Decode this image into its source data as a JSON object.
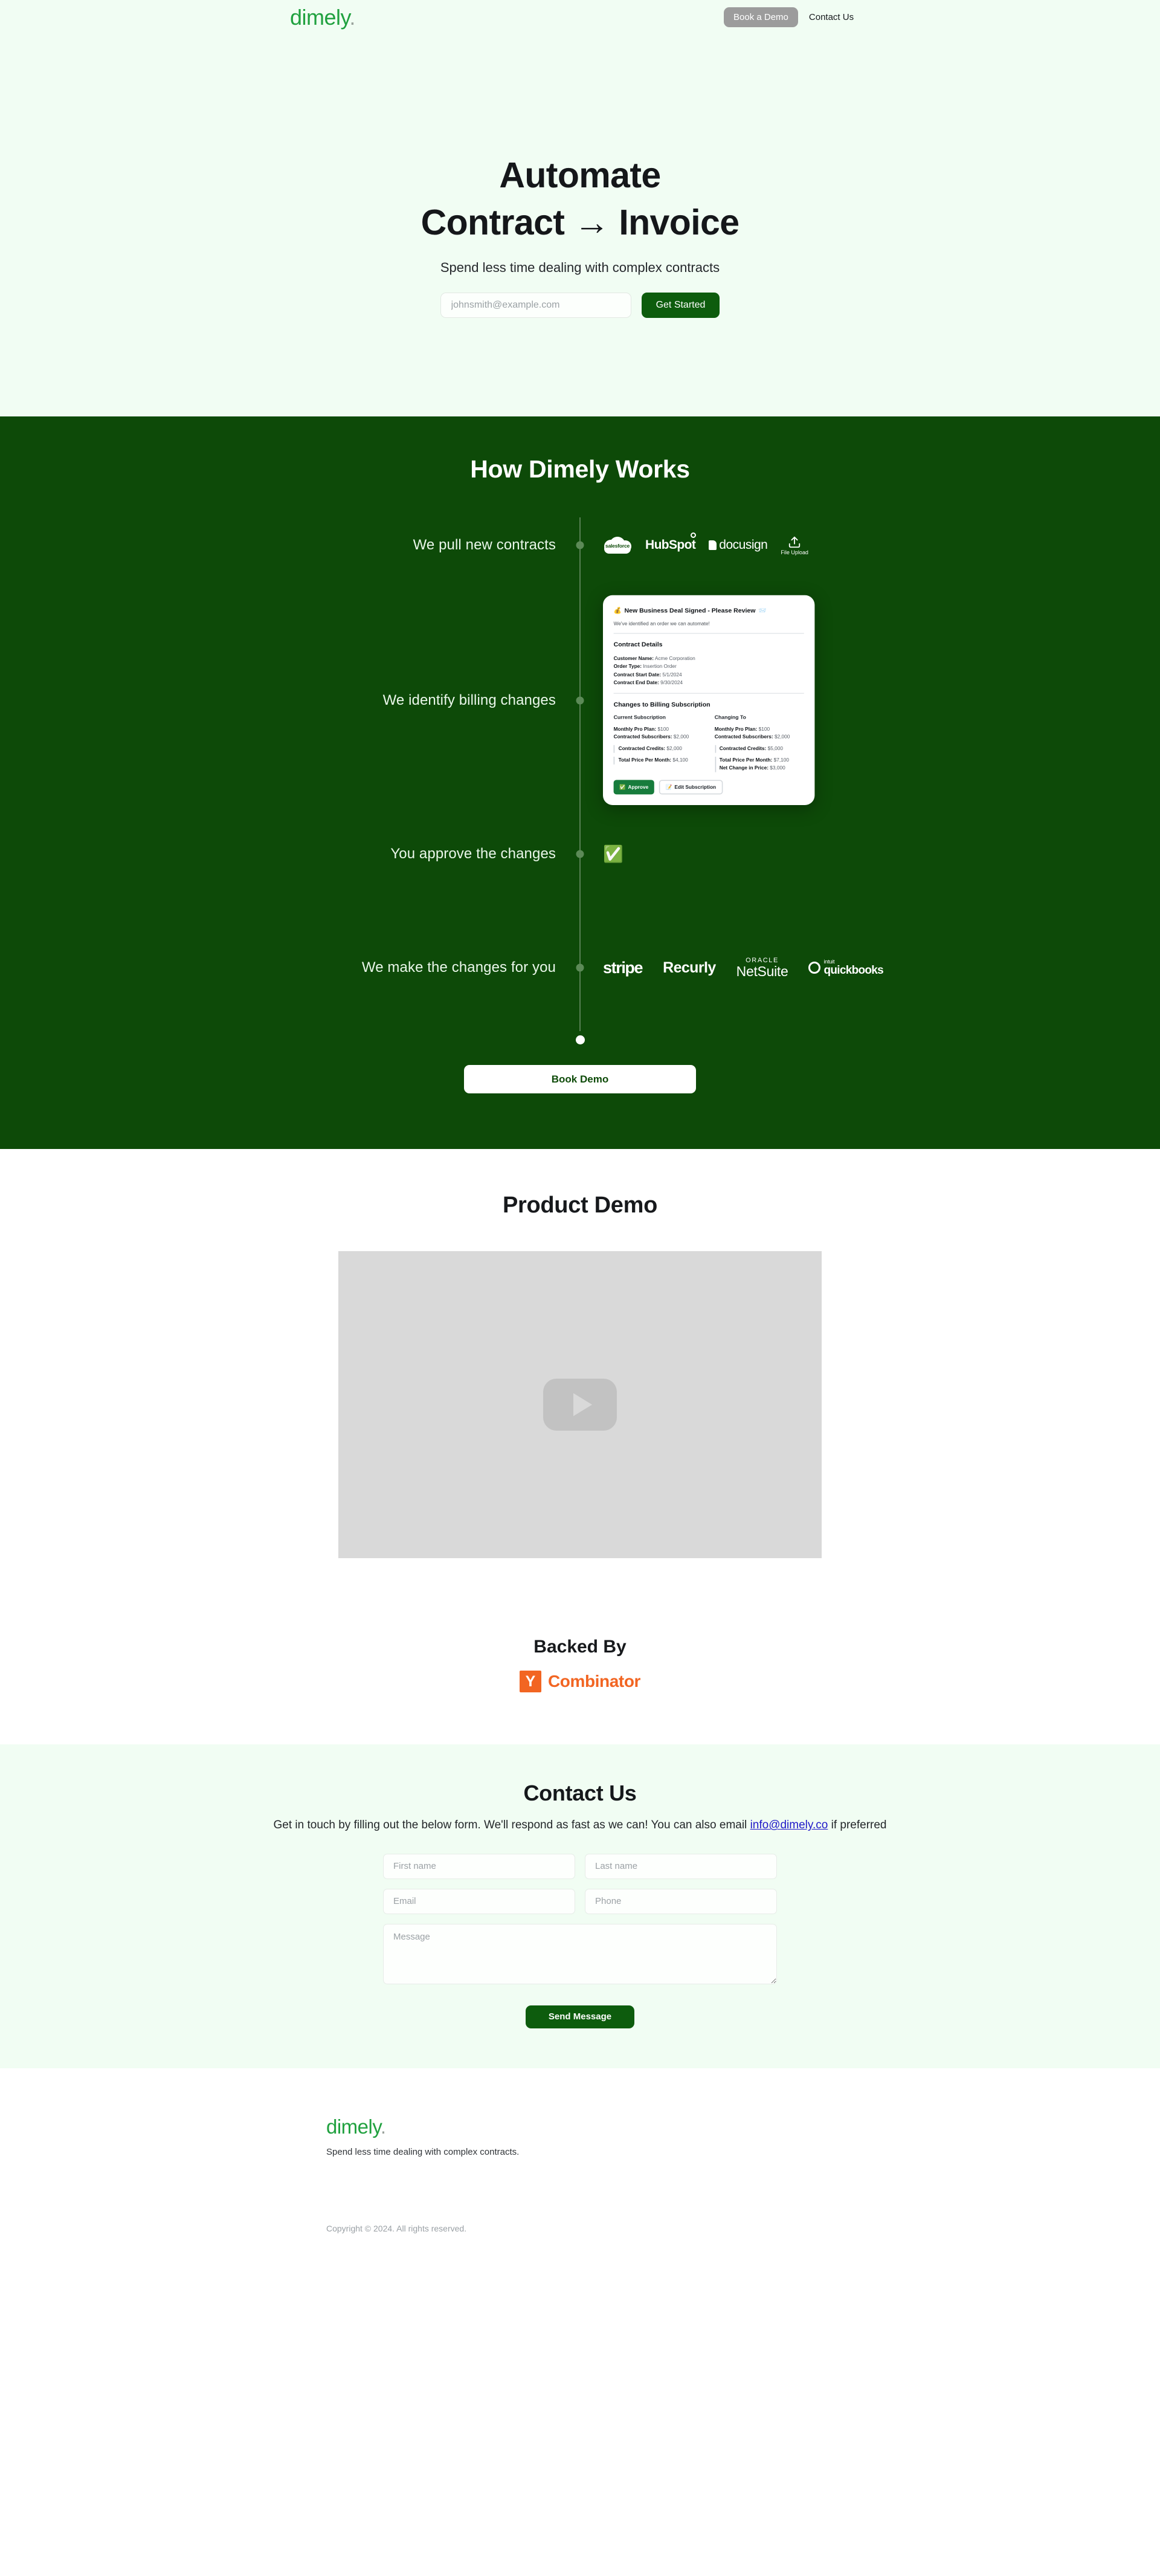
{
  "brand": {
    "name": "dimely",
    "dot": ".",
    "accent_green": "#20a13f",
    "dark_green": "#0d4a08",
    "button_green": "#0d5c0d"
  },
  "nav": {
    "book_demo": "Book a Demo",
    "contact": "Contact Us"
  },
  "hero": {
    "title_line1": "Automate",
    "title_line2": "Contract → Invoice",
    "subtitle": "Spend less time dealing with complex contracts",
    "email_placeholder": "johnsmith@example.com",
    "email_value": "",
    "cta": "Get Started"
  },
  "how": {
    "heading": "How Dimely Works",
    "steps": [
      {
        "label": "We pull new contracts",
        "kind": "logos"
      },
      {
        "label": "We identify billing changes",
        "kind": "card"
      },
      {
        "label": "You approve the changes",
        "kind": "check"
      },
      {
        "label": "We make the changes for you",
        "kind": "billing-logos"
      }
    ],
    "source_logos": [
      "salesforce",
      "HubSpot",
      "docusign",
      "File Upload"
    ],
    "billing_logos": [
      "stripe",
      "Recurly",
      "ORACLE NetSuite",
      "intuit quickbooks"
    ],
    "netsuite": {
      "oracle": "ORACLE",
      "netsuite": "NetSuite"
    },
    "quickbooks": {
      "intuit": "intuit",
      "name": "quickbooks"
    },
    "file_upload_caption": "File Upload",
    "book_demo": "Book Demo"
  },
  "contract_card": {
    "title": "New Business Deal Signed - Please Review",
    "title_emoji_left": "💰",
    "title_emoji_right": "📨",
    "subtitle": "We've identified an order we can automate!",
    "details_heading": "Contract Details",
    "details": [
      {
        "key": "Customer Name:",
        "value": "Acme Corporation"
      },
      {
        "key": "Order Type:",
        "value": "Insertion Order"
      },
      {
        "key": "Contract Start Date:",
        "value": "5/1/2024"
      },
      {
        "key": "Contract End Date:",
        "value": "9/30/2024"
      }
    ],
    "changes_heading": "Changes to Billing Subscription",
    "current": {
      "title": "Current Subscription",
      "lines": [
        {
          "key": "Monthly Pro Plan:",
          "value": "$100"
        },
        {
          "key": "Contracted Subscribers:",
          "value": "$2,000"
        }
      ],
      "quote1": [
        {
          "key": "Contracted Credits:",
          "value": "$2,000"
        }
      ],
      "quote2": [
        {
          "key": "Total Price Per Month:",
          "value": "$4,100"
        }
      ]
    },
    "changing_to": {
      "title": "Changing To",
      "lines": [
        {
          "key": "Monthly Pro Plan:",
          "value": "$100"
        },
        {
          "key": "Contracted Subscribers:",
          "value": "$2,000"
        }
      ],
      "quote1": [
        {
          "key": "Contracted Credits:",
          "value": "$5,000"
        }
      ],
      "quote2": [
        {
          "key": "Total Price Per Month:",
          "value": "$7,100"
        },
        {
          "key": "Net Change in Price:",
          "value": "$3,000"
        }
      ]
    },
    "approve_button": "Approve",
    "approve_emoji": "✅",
    "edit_button": "Edit Subscription",
    "edit_emoji": "📝"
  },
  "approve_step": {
    "emoji": "✅"
  },
  "demo": {
    "heading": "Product Demo",
    "play_label": "play"
  },
  "backed": {
    "heading": "Backed By",
    "investor_mark": "Y",
    "investor_name": "Combinator",
    "investor_color": "#f26522"
  },
  "contact": {
    "heading": "Contact Us",
    "desc_part1": "Get in touch by filling out the below form. We'll respond as fast as we can! You can also email ",
    "email": "info@dimely.co",
    "desc_part2": " if preferred",
    "fields": {
      "first_name": "First name",
      "last_name": "Last name",
      "email": "Email",
      "phone": "Phone",
      "message": "Message"
    },
    "submit": "Send Message"
  },
  "footer": {
    "logo": "dimely",
    "dot": ".",
    "tagline": "Spend less time dealing with complex contracts.",
    "copyright": "Copyright © 2024. All rights reserved."
  }
}
